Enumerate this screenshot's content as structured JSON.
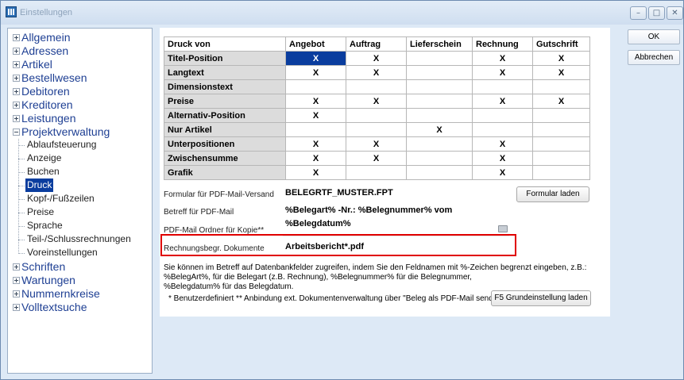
{
  "window": {
    "title": "Einstellungen"
  },
  "tree": {
    "top_items": [
      {
        "label": "Allgemein",
        "expanded": false
      },
      {
        "label": "Adressen",
        "expanded": false
      },
      {
        "label": "Artikel",
        "expanded": false
      },
      {
        "label": "Bestellwesen",
        "expanded": false
      },
      {
        "label": "Debitoren",
        "expanded": false
      },
      {
        "label": "Kreditoren",
        "expanded": false
      },
      {
        "label": "Leistungen",
        "expanded": false
      },
      {
        "label": "Projektverwaltung",
        "expanded": true
      },
      {
        "label": "Schriften",
        "expanded": false
      },
      {
        "label": "Wartungen",
        "expanded": false
      },
      {
        "label": "Nummernkreise",
        "expanded": false
      },
      {
        "label": "Volltextsuche",
        "expanded": false
      }
    ],
    "sub_items": [
      {
        "label": "Ablaufsteuerung",
        "selected": false
      },
      {
        "label": "Anzeige",
        "selected": false
      },
      {
        "label": "Buchen",
        "selected": false
      },
      {
        "label": "Druck",
        "selected": true
      },
      {
        "label": "Kopf-/Fußzeilen",
        "selected": false
      },
      {
        "label": "Preise",
        "selected": false
      },
      {
        "label": "Sprache",
        "selected": false
      },
      {
        "label": "Teil-/Schlussrechnungen",
        "selected": false
      },
      {
        "label": "Voreinstellungen",
        "selected": false
      }
    ]
  },
  "grid": {
    "headers": [
      "Druck von",
      "Angebot",
      "Auftrag",
      "Lieferschein",
      "Rechnung",
      "Gutschrift"
    ],
    "rows": [
      {
        "label": "Titel-Position",
        "cells": [
          "X",
          "X",
          "",
          "X",
          "X"
        ]
      },
      {
        "label": "Langtext",
        "cells": [
          "X",
          "X",
          "",
          "X",
          "X"
        ]
      },
      {
        "label": "Dimensionstext",
        "cells": [
          "",
          "",
          "",
          "",
          ""
        ]
      },
      {
        "label": "Preise",
        "cells": [
          "X",
          "X",
          "",
          "X",
          "X"
        ]
      },
      {
        "label": "Alternativ-Position",
        "cells": [
          "X",
          "",
          "",
          "",
          ""
        ]
      },
      {
        "label": "Nur Artikel",
        "cells": [
          "",
          "",
          "X",
          "",
          ""
        ]
      },
      {
        "label": "Unterpositionen",
        "cells": [
          "X",
          "X",
          "",
          "X",
          ""
        ]
      },
      {
        "label": "Zwischensumme",
        "cells": [
          "X",
          "X",
          "",
          "X",
          ""
        ]
      },
      {
        "label": "Grafik",
        "cells": [
          "X",
          "",
          "",
          "X",
          ""
        ]
      }
    ]
  },
  "form": {
    "pdf_formular_label": "Formular für PDF-Mail-Versand",
    "pdf_formular_value": "BELEGRTF_MUSTER.FPT",
    "formular_laden_label": "Formular laden",
    "betreff_label": "Betreff für PDF-Mail",
    "betreff_value": "%Belegart% -Nr.: %Belegnummer% vom %Belegdatum%",
    "ordner_label": "PDF-Mail Ordner für Kopie**",
    "ordner_value": "",
    "rechnungsbegr_label": "Rechnungsbegr. Dokumente",
    "rechnungsbegr_value": "Arbeitsbericht*.pdf",
    "info_line1": "Sie können im Betreff auf Datenbankfelder zugreifen, indem Sie den Feldnamen mit %-Zeichen begrenzt eingeben, z.B.:",
    "info_line2": "%BelegArt%, für die Belegart (z.B. Rechnung), %Belegnummer% für die Belegnummer,",
    "info_line3": "%Belegdatum% für das Belegdatum.",
    "footnote": "* Benutzerdefiniert  ** Anbindung ext. Dokumentenverwaltung über \"Beleg als PDF-Mail senden\"",
    "f5_label": "F5 Grundeinstellung laden"
  },
  "buttons": {
    "ok": "OK",
    "abbrechen": "Abbrechen"
  },
  "icons": {
    "minimize": "minimize-icon",
    "maximize": "maximize-icon",
    "close": "close-icon",
    "folder": "folder-icon"
  },
  "colors": {
    "selection": "#0a3d9e",
    "highlight_border": "#e00000",
    "window_bg": "#dde9f6"
  }
}
